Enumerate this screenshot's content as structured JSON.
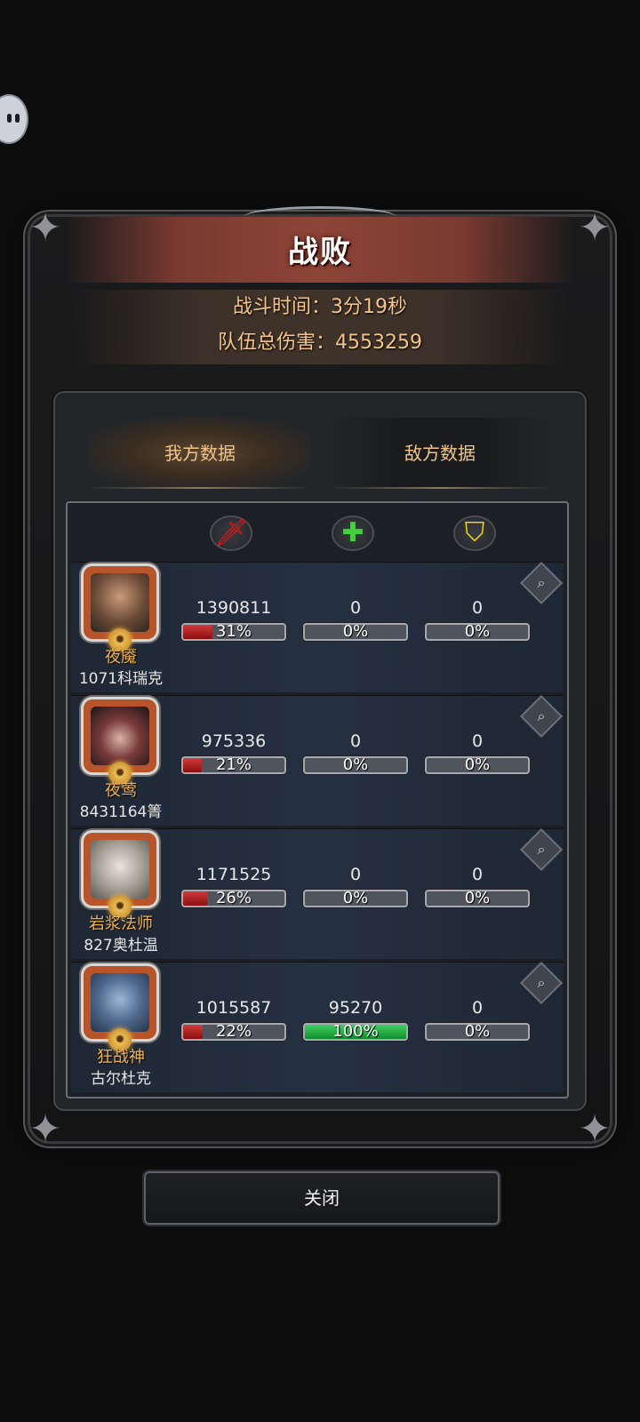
{
  "result_title": "战败",
  "summary": {
    "battle_time": "战斗时间：3分19秒",
    "total_damage": "队伍总伤害：4553259"
  },
  "tabs": {
    "ours": "我方数据",
    "enemy": "敌方数据"
  },
  "icons": {
    "damage": "sword-icon",
    "heal": "heal-cross-icon",
    "defense": "shield-icon",
    "detail": "magnifier-icon"
  },
  "colors": {
    "damage_bar": "#c62828",
    "heal_bar": "#2bb24c",
    "heal_icon": "#43d13b",
    "shield_icon": "#f2d21b",
    "sword_icon": "#e01919",
    "title_banner": "#8d4537"
  },
  "rows": [
    {
      "hero": "夜魇",
      "player": "1071科瑞克",
      "damage": "1390811",
      "damage_pct": "31%",
      "damage_frac": 0.31,
      "heal": "0",
      "heal_pct": "0%",
      "heal_frac": 0,
      "defense": "0",
      "defense_pct": "0%",
      "defense_frac": 0
    },
    {
      "hero": "夜莺",
      "player": "8431164箐",
      "damage": "975336",
      "damage_pct": "21%",
      "damage_frac": 0.21,
      "heal": "0",
      "heal_pct": "0%",
      "heal_frac": 0,
      "defense": "0",
      "defense_pct": "0%",
      "defense_frac": 0
    },
    {
      "hero": "岩浆法师",
      "player": "827奥杜温",
      "damage": "1171525",
      "damage_pct": "26%",
      "damage_frac": 0.26,
      "heal": "0",
      "heal_pct": "0%",
      "heal_frac": 0,
      "defense": "0",
      "defense_pct": "0%",
      "defense_frac": 0
    },
    {
      "hero": "狂战神",
      "player": "古尔杜克",
      "damage": "1015587",
      "damage_pct": "22%",
      "damage_frac": 0.22,
      "heal": "95270",
      "heal_pct": "100%",
      "heal_frac": 1.0,
      "defense": "0",
      "defense_pct": "0%",
      "defense_frac": 0
    }
  ],
  "close_label": "关闭"
}
